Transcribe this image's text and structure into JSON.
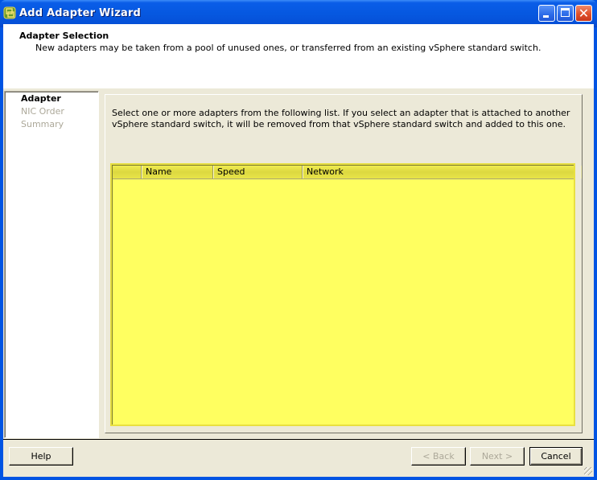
{
  "window": {
    "title": "Add Adapter Wizard",
    "controls": {
      "minimize": "_",
      "maximize": "□",
      "close": "✕"
    }
  },
  "header": {
    "title": "Adapter Selection",
    "description": "New adapters may be taken from a pool of unused ones, or transferred from an existing vSphere standard switch."
  },
  "steps": [
    {
      "label": "Adapter",
      "state": "active"
    },
    {
      "label": "NIC Order",
      "state": "inactive"
    },
    {
      "label": "Summary",
      "state": "inactive"
    }
  ],
  "content": {
    "instructions": "Select one or more adapters from the following list. If you select an adapter that is attached to another vSphere standard switch, it will be removed from that vSphere standard switch and added to this one.",
    "table": {
      "columns": [
        "",
        "Name",
        "Speed",
        "Network"
      ],
      "rows": [],
      "highlight_color": "#ffff60"
    }
  },
  "footer": {
    "help": "Help",
    "back": "< Back",
    "next": "Next >",
    "cancel": "Cancel"
  }
}
